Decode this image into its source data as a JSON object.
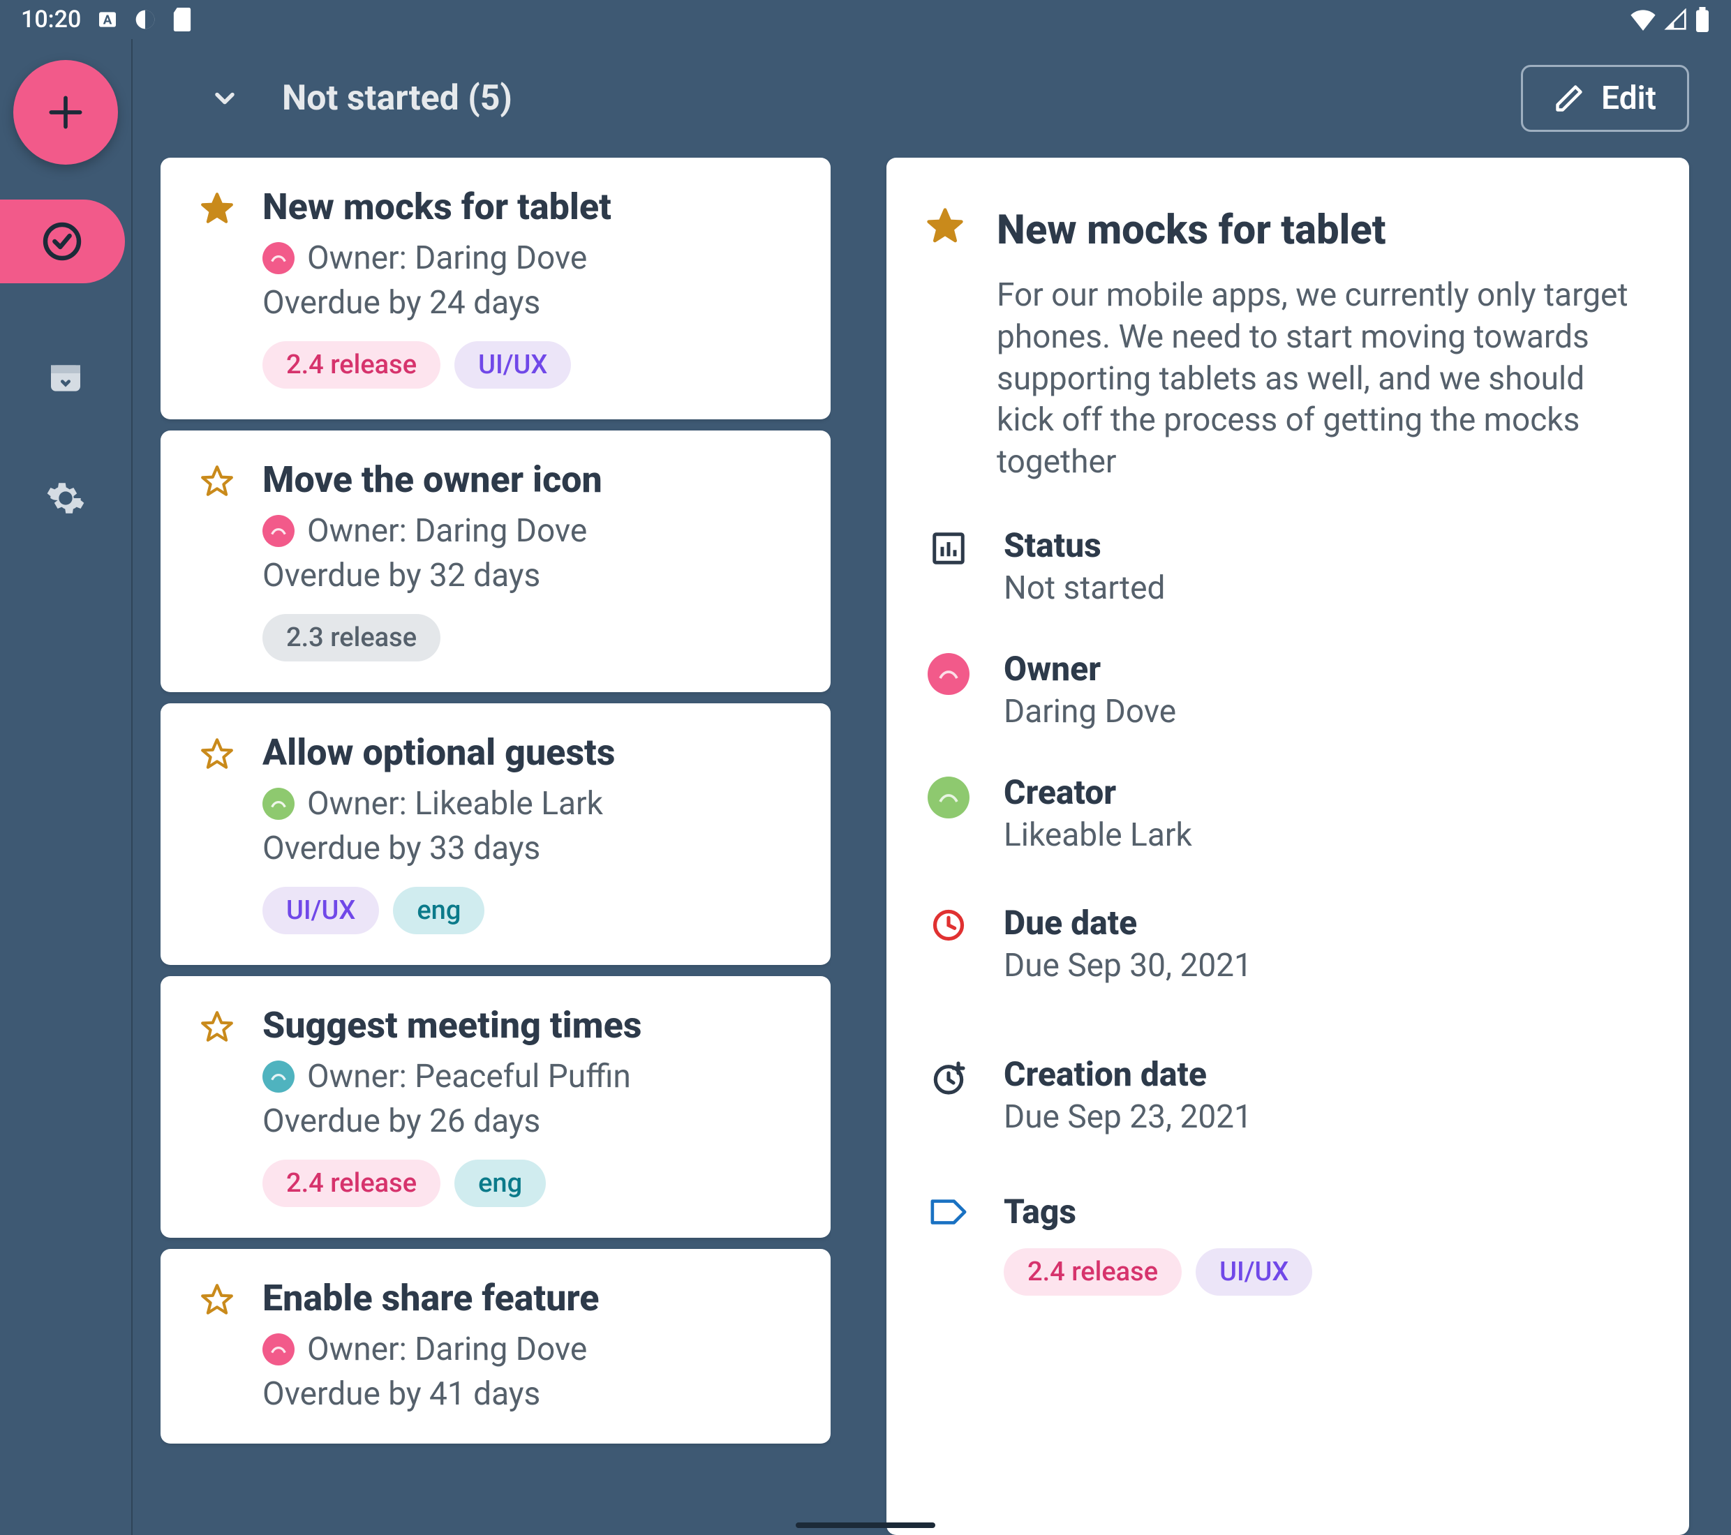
{
  "status_bar": {
    "time": "10:20"
  },
  "header": {
    "title": "Not started (5)",
    "edit_label": "Edit"
  },
  "tasks": [
    {
      "starred": true,
      "title": "New mocks for tablet",
      "owner_label": "Owner: Daring Dove",
      "owner_color": "pink",
      "overdue": "Overdue by 24 days",
      "tags": [
        {
          "label": "2.4 release",
          "style": "pink"
        },
        {
          "label": "UI/UX",
          "style": "purple"
        }
      ]
    },
    {
      "starred": false,
      "title": "Move the owner icon",
      "owner_label": "Owner: Daring Dove",
      "owner_color": "pink",
      "overdue": "Overdue by 32 days",
      "tags": [
        {
          "label": "2.3 release",
          "style": "gray"
        }
      ]
    },
    {
      "starred": false,
      "title": "Allow optional guests",
      "owner_label": "Owner: Likeable Lark",
      "owner_color": "green",
      "overdue": "Overdue by 33 days",
      "tags": [
        {
          "label": "UI/UX",
          "style": "purple"
        },
        {
          "label": "eng",
          "style": "teal"
        }
      ]
    },
    {
      "starred": false,
      "title": "Suggest meeting times",
      "owner_label": "Owner: Peaceful Puffin",
      "owner_color": "teal",
      "overdue": "Overdue by 26 days",
      "tags": [
        {
          "label": "2.4 release",
          "style": "pink"
        },
        {
          "label": "eng",
          "style": "teal"
        }
      ]
    },
    {
      "starred": false,
      "title": "Enable share feature",
      "owner_label": "Owner: Daring Dove",
      "owner_color": "pink",
      "overdue": "Overdue by 41 days",
      "tags": []
    }
  ],
  "detail": {
    "starred": true,
    "title": "New mocks for tablet",
    "description": "For our mobile apps, we currently only target phones. We need to start moving towards supporting tablets as well, and we should kick off the process of getting the mocks together",
    "status": {
      "label": "Status",
      "value": "Not started"
    },
    "owner": {
      "label": "Owner",
      "value": "Daring Dove",
      "color": "pink"
    },
    "creator": {
      "label": "Creator",
      "value": "Likeable Lark",
      "color": "green"
    },
    "due_date": {
      "label": "Due date",
      "value": "Due Sep 30, 2021"
    },
    "creation_date": {
      "label": "Creation date",
      "value": "Due Sep 23, 2021"
    },
    "tags_label": "Tags",
    "tags": [
      {
        "label": "2.4 release",
        "style": "pink"
      },
      {
        "label": "UI/UX",
        "style": "purple"
      }
    ]
  }
}
